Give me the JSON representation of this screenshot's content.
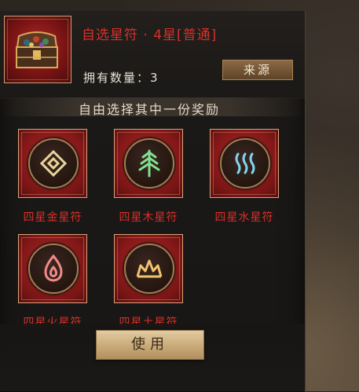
{
  "item": {
    "title": "自选星符 · 4星[普通]",
    "quantity": "拥有数量：3",
    "source_button": "来源"
  },
  "instruction": "自由选择其中一份奖励",
  "rewards": [
    {
      "label": "四星金星符",
      "icon": "metal-diamond-icon",
      "color": "#e9d59a"
    },
    {
      "label": "四星木星符",
      "icon": "wood-tree-icon",
      "color": "#7fe08e"
    },
    {
      "label": "四星水星符",
      "icon": "water-waves-icon",
      "color": "#7fd3ee"
    },
    {
      "label": "四星火星符",
      "icon": "fire-flame-icon",
      "color": "#f08a86"
    },
    {
      "label": "四星土星符",
      "icon": "earth-mountain-icon",
      "color": "#f2c36b"
    }
  ],
  "use_button": "使用"
}
